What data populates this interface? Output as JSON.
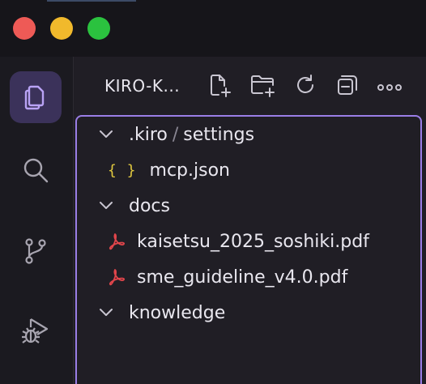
{
  "colors": {
    "accent": "#9a7ee6",
    "active_bg": "#3b325a",
    "json_icon": "#e0c83f",
    "pdf_icon": "#e0454b"
  },
  "titlebar": {
    "buttons": [
      "close",
      "minimize",
      "maximize"
    ]
  },
  "activitybar": {
    "items": [
      {
        "name": "explorer",
        "icon": "files-icon",
        "active": true
      },
      {
        "name": "search",
        "icon": "search-icon",
        "active": false
      },
      {
        "name": "source-control",
        "icon": "source-control-icon",
        "active": false
      },
      {
        "name": "run-and-debug",
        "icon": "run-debug-icon",
        "active": false
      }
    ]
  },
  "sidebar": {
    "title": "KIRO-K...",
    "actions": [
      "new-file-icon",
      "new-folder-icon",
      "refresh-icon",
      "collapse-all-icon",
      "more-icon"
    ]
  },
  "tree": {
    "folder_kiro": {
      "name_a": ".kiro",
      "separator": "/",
      "name_b": "settings"
    },
    "file_mcp": {
      "icon_text": "{ }",
      "name": "mcp.json"
    },
    "folder_docs": {
      "name": "docs"
    },
    "file_pdf1": {
      "name": "kaisetsu_2025_soshiki.pdf"
    },
    "file_pdf2": {
      "name": "sme_guideline_v4.0.pdf"
    },
    "folder_knowledge": {
      "name": "knowledge"
    }
  }
}
